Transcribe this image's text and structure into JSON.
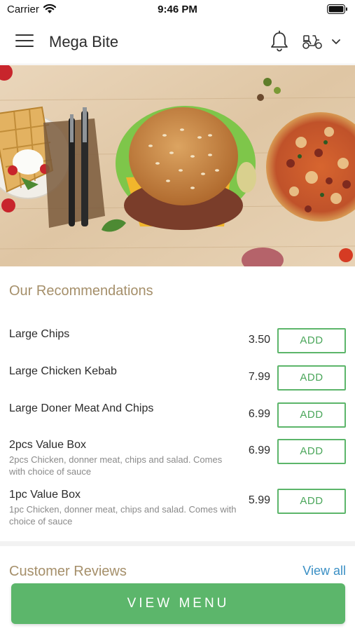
{
  "status_bar": {
    "carrier": "Carrier",
    "time": "9:46 PM"
  },
  "header": {
    "title": "Mega Bite",
    "icons": [
      "menu-icon",
      "bell-icon",
      "scooter-icon",
      "chevron-down-icon"
    ]
  },
  "recommendations": {
    "title": "Our Recommendations",
    "items": [
      {
        "name": "Large Chips",
        "description": "",
        "price": "3.50",
        "button": "ADD"
      },
      {
        "name": "Large Chicken Kebab",
        "description": "",
        "price": "7.99",
        "button": "ADD"
      },
      {
        "name": "Large Doner Meat And Chips",
        "description": "",
        "price": "6.99",
        "button": "ADD"
      },
      {
        "name": "2pcs Value Box",
        "description": "2pcs Chicken, donner meat, chips and salad. Comes with choice of sauce",
        "price": "6.99",
        "button": "ADD"
      },
      {
        "name": "1pc Value Box",
        "description": "1pc Chicken, donner meat, chips and salad. Comes with choice of sauce",
        "price": "5.99",
        "button": "ADD"
      }
    ]
  },
  "reviews": {
    "title": "Customer Reviews",
    "view_all": "View all"
  },
  "cta": {
    "label": "VIEW MENU"
  },
  "colors": {
    "accent_green": "#5cb66b",
    "section_title": "#a58f6a",
    "link_blue": "#3a8fc4"
  }
}
